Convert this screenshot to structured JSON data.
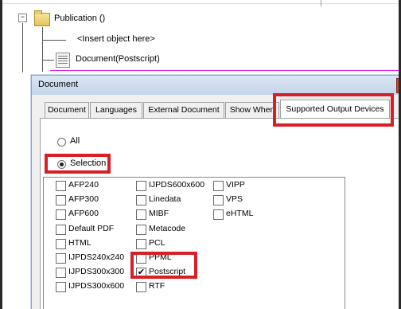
{
  "tree": {
    "root_label": "Publication ()",
    "root_expander": "−",
    "items": [
      {
        "label": "<Insert object here>"
      },
      {
        "label": "Document(Postscript)"
      }
    ]
  },
  "dialog": {
    "title": "Document",
    "tabs": [
      {
        "label": "Document",
        "active": false
      },
      {
        "label": "Languages",
        "active": false
      },
      {
        "label": "External Document",
        "active": false
      },
      {
        "label": "Show When",
        "active": false
      },
      {
        "label": "Supported Output Devices",
        "active": true
      }
    ],
    "radios": [
      {
        "label": "All",
        "selected": false
      },
      {
        "label": "Selection",
        "selected": true
      }
    ],
    "devices": [
      {
        "label": "AFP240",
        "checked": false
      },
      {
        "label": "AFP300",
        "checked": false
      },
      {
        "label": "AFP600",
        "checked": false
      },
      {
        "label": "Default PDF",
        "checked": false
      },
      {
        "label": "HTML",
        "checked": false
      },
      {
        "label": "IJPDS240x240",
        "checked": false
      },
      {
        "label": "IJPDS300x300",
        "checked": false
      },
      {
        "label": "IJPDS300x600",
        "checked": false
      },
      {
        "label": "IJPDS600x600",
        "checked": false
      },
      {
        "label": "Linedata",
        "checked": false
      },
      {
        "label": "MIBF",
        "checked": false
      },
      {
        "label": "Metacode",
        "checked": false
      },
      {
        "label": "PCL",
        "checked": false
      },
      {
        "label": "PPML",
        "checked": false
      },
      {
        "label": "Postscript",
        "checked": true
      },
      {
        "label": "RTF",
        "checked": false
      },
      {
        "label": "VIPP",
        "checked": false
      },
      {
        "label": "VPS",
        "checked": false
      },
      {
        "label": "eHTML",
        "checked": false
      }
    ],
    "check_mark": "✔"
  },
  "colors": {
    "highlight": "#d81f26",
    "drop_line": "#e21ee2"
  }
}
